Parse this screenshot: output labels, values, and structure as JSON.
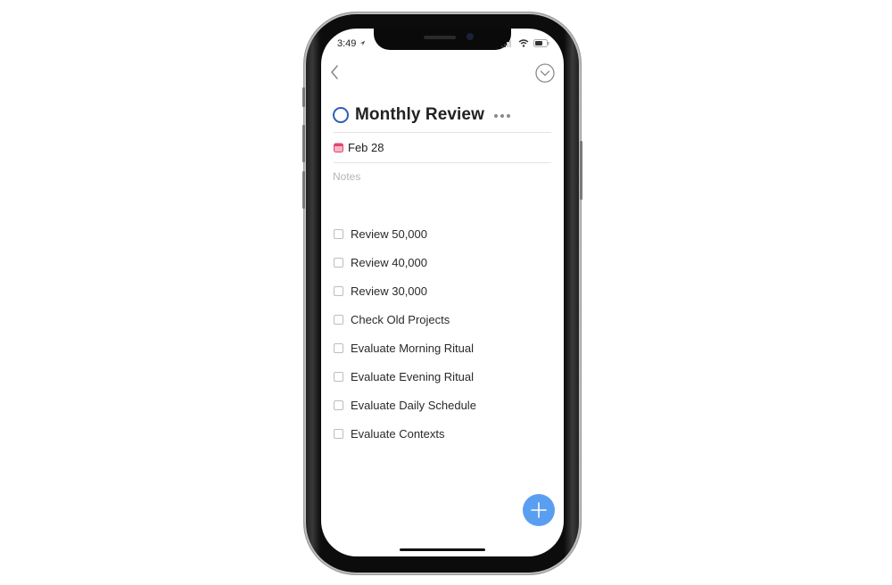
{
  "status_bar": {
    "time": "3:49",
    "icons": [
      "location-arrow-icon",
      "signal-icon",
      "wifi-icon",
      "battery-icon"
    ]
  },
  "nav": {
    "back_icon": "chevron-left-icon",
    "collapse_icon": "chevron-down-circle-icon"
  },
  "task": {
    "title": "Monthly Review",
    "more_icon": "ellipsis-icon",
    "due_date": "Feb 28",
    "notes_placeholder": "Notes"
  },
  "checklist": [
    {
      "label": "Review 50,000",
      "checked": false
    },
    {
      "label": "Review 40,000",
      "checked": false
    },
    {
      "label": "Review 30,000",
      "checked": false
    },
    {
      "label": "Check Old Projects",
      "checked": false
    },
    {
      "label": "Evaluate Morning Ritual",
      "checked": false
    },
    {
      "label": "Evaluate Evening Ritual",
      "checked": false
    },
    {
      "label": "Evaluate Daily Schedule",
      "checked": false
    },
    {
      "label": "Evaluate Contexts",
      "checked": false
    }
  ],
  "fab": {
    "icon": "plus-icon"
  },
  "colors": {
    "accent": "#5a9ef2",
    "title_circle": "#2e5fb8",
    "calendar": "#e0476e"
  }
}
